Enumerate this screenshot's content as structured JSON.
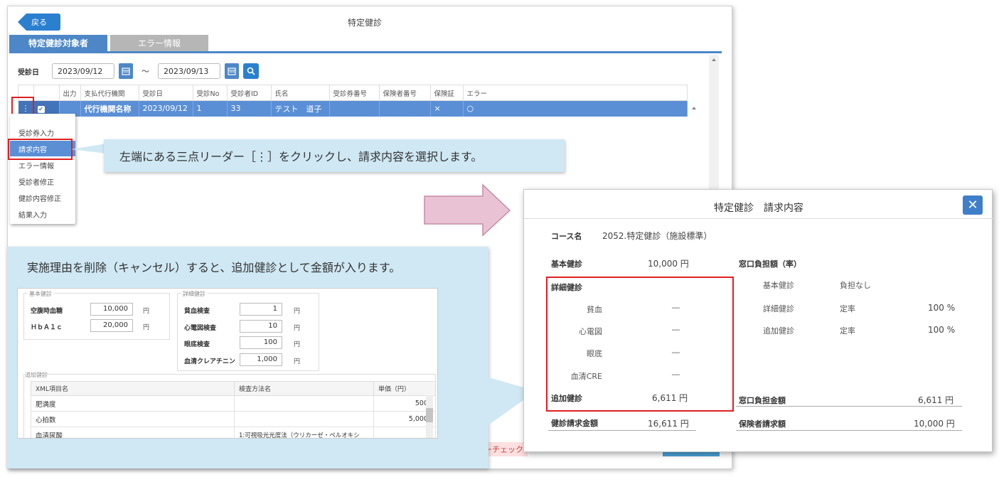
{
  "window": {
    "title": "特定健診",
    "back_label": "戻る",
    "tabs": [
      {
        "label": "特定健診対象者",
        "active": true
      },
      {
        "label": "エラー情報",
        "active": false
      }
    ]
  },
  "filter": {
    "label": "受診日",
    "from": "2023/09/12",
    "sep": "～",
    "to": "2023/09/13"
  },
  "grid": {
    "headers": [
      "",
      "",
      "出力",
      "支払代行機関",
      "受診日",
      "受診No",
      "受診者ID",
      "氏名",
      "受診券番号",
      "保険者番号",
      "保険証",
      "エラー"
    ],
    "row": [
      "⋮",
      "",
      "",
      "代行機関名称",
      "2023/09/12",
      "1",
      "33",
      "テスト　道子",
      "",
      "",
      "×",
      "○"
    ]
  },
  "row_menu": {
    "items": [
      "受診券入力",
      "請求内容",
      "エラー情報",
      "受診者修正",
      "健診内容修正",
      "結果入力"
    ],
    "selected_index": 1
  },
  "callout1": {
    "text": "左端にある三点リーダー［⋮］をクリックし、請求内容を選択します。"
  },
  "callout2": {
    "text": "実施理由を削除（キャンセル）すると、追加健診として金額が入ります。"
  },
  "inner_form": {
    "fs_basic": "基本健診",
    "fs_detail": "詳細健診",
    "fs_extra": "追加健診",
    "basic_items": [
      {
        "label": "空腹時血糖",
        "value": "10,000",
        "unit": "円"
      },
      {
        "label": "ＨｂＡ１ｃ",
        "value": "20,000",
        "unit": "円"
      }
    ],
    "detail_items": [
      {
        "label": "貧血検査",
        "value": "1",
        "unit": "円"
      },
      {
        "label": "心電図検査",
        "value": "10",
        "unit": "円"
      },
      {
        "label": "眼底検査",
        "value": "100",
        "unit": "円"
      },
      {
        "label": "血清クレアチニン",
        "value": "1,000",
        "unit": "円"
      }
    ],
    "xml_headers": [
      "XML項目名",
      "検査方法名",
      "単価（円）"
    ],
    "xml_rows": [
      [
        "肥満度",
        "",
        "500"
      ],
      [
        "心拍数",
        "",
        "5,000"
      ],
      [
        "血清尿酸",
        "1:可視吸光光度法（ウリカーゼ・ペルオキシ",
        ""
      ]
    ]
  },
  "bottom_check_label": "ーチェック",
  "dialog": {
    "title": "特定健診　請求内容",
    "close_label": "✕",
    "course_label": "コース名",
    "course_value": "2052.特定健診（施設標準）",
    "basic_label": "基本健診",
    "basic_value": "10,000 円",
    "detail_label": "詳細健診",
    "detail_items": [
      {
        "label": "貧血",
        "value": "―"
      },
      {
        "label": "心電図",
        "value": "―"
      },
      {
        "label": "眼底",
        "value": "―"
      },
      {
        "label": "血清CRE",
        "value": "―"
      }
    ],
    "extra_label": "追加健診",
    "extra_value": "6,611 円",
    "total_label": "健診請求金額",
    "total_value": "16,611 円",
    "window_rate_label": "窓口負担額（率）",
    "window_rates": [
      {
        "label": "基本健診",
        "type": "負担なし",
        "rate": ""
      },
      {
        "label": "詳細健診",
        "type": "定率",
        "rate": "100 %"
      },
      {
        "label": "追加健診",
        "type": "定率",
        "rate": "100 %"
      }
    ],
    "window_amount_label": "窓口負担金額",
    "window_amount_value": "6,611 円",
    "insurer_label": "保険者請求額",
    "insurer_value": "10,000 円"
  },
  "colors": {
    "accent": "#4d87c7",
    "highlight": "#e02020",
    "callout": "#cfe8f4",
    "arrow": "#e9c3d3"
  }
}
